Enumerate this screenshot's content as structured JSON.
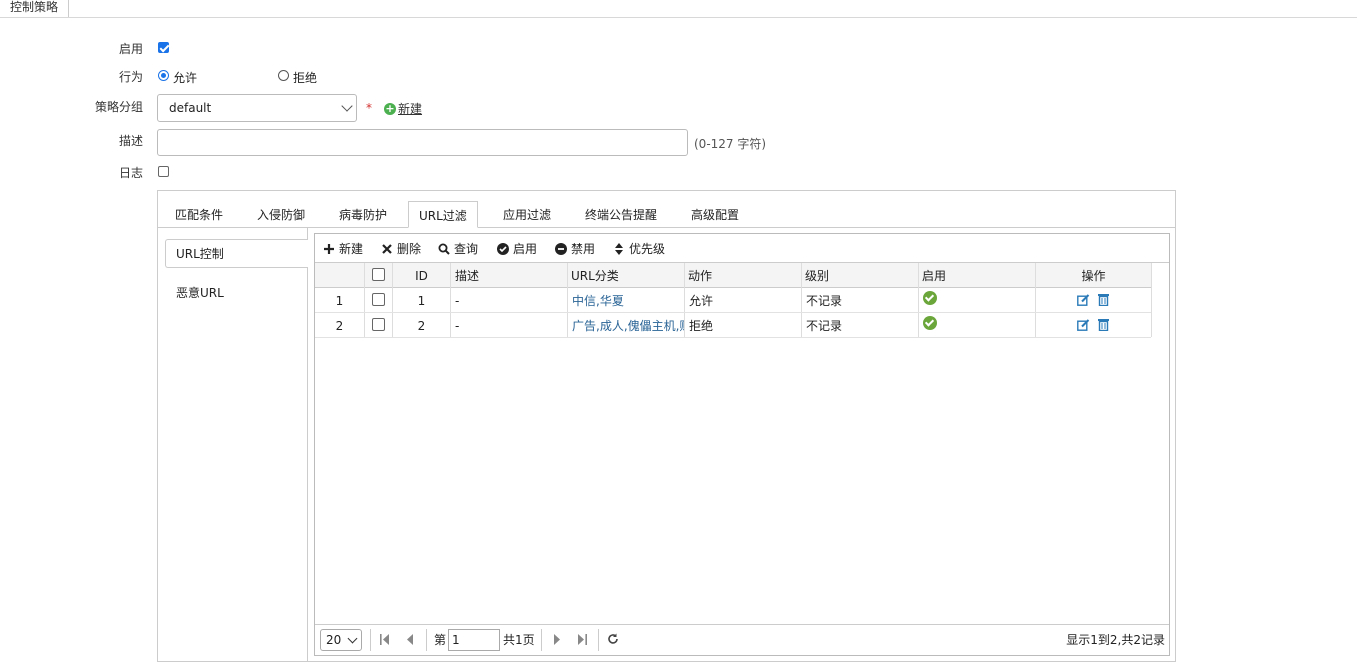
{
  "top_tab": {
    "label": "控制策略"
  },
  "form": {
    "enable_label": "启用",
    "action_label": "行为",
    "action_allow": "允许",
    "action_deny": "拒绝",
    "group_label": "策略分组",
    "group_value": "default",
    "required_mark": "*",
    "new_group_label": "新建",
    "desc_label": "描述",
    "desc_value": "",
    "desc_hint": "(0-127 字符)",
    "log_label": "日志"
  },
  "tabs": [
    "匹配条件",
    "入侵防御",
    "病毒防护",
    "URL过滤",
    "应用过滤",
    "终端公告提醒",
    "高级配置"
  ],
  "active_tab": "URL过滤",
  "side_nav": [
    "URL控制",
    "恶意URL"
  ],
  "toolbar": {
    "new": "新建",
    "delete": "删除",
    "query": "查询",
    "enable": "启用",
    "disable": "禁用",
    "priority": "优先级"
  },
  "table": {
    "headers": [
      "",
      "",
      "ID",
      "描述",
      "URL分类",
      "动作",
      "级别",
      "启用",
      "操作"
    ],
    "rows": [
      {
        "num": "1",
        "id": "1",
        "desc": "-",
        "category": "中信,华夏",
        "action": "允许",
        "level": "不记录",
        "enabled": true
      },
      {
        "num": "2",
        "id": "2",
        "desc": "-",
        "category": "广告,成人,傀儡主机,赌",
        "action": "拒绝",
        "level": "不记录",
        "enabled": true
      }
    ]
  },
  "pager": {
    "page_size": "20",
    "page_prefix": "第",
    "page_value": "1",
    "page_total": "共1页",
    "summary": "显示1到2,共2记录"
  },
  "colors": {
    "accent": "#1a73e8",
    "link": "#2a6496",
    "ok": "#6aa63a"
  }
}
